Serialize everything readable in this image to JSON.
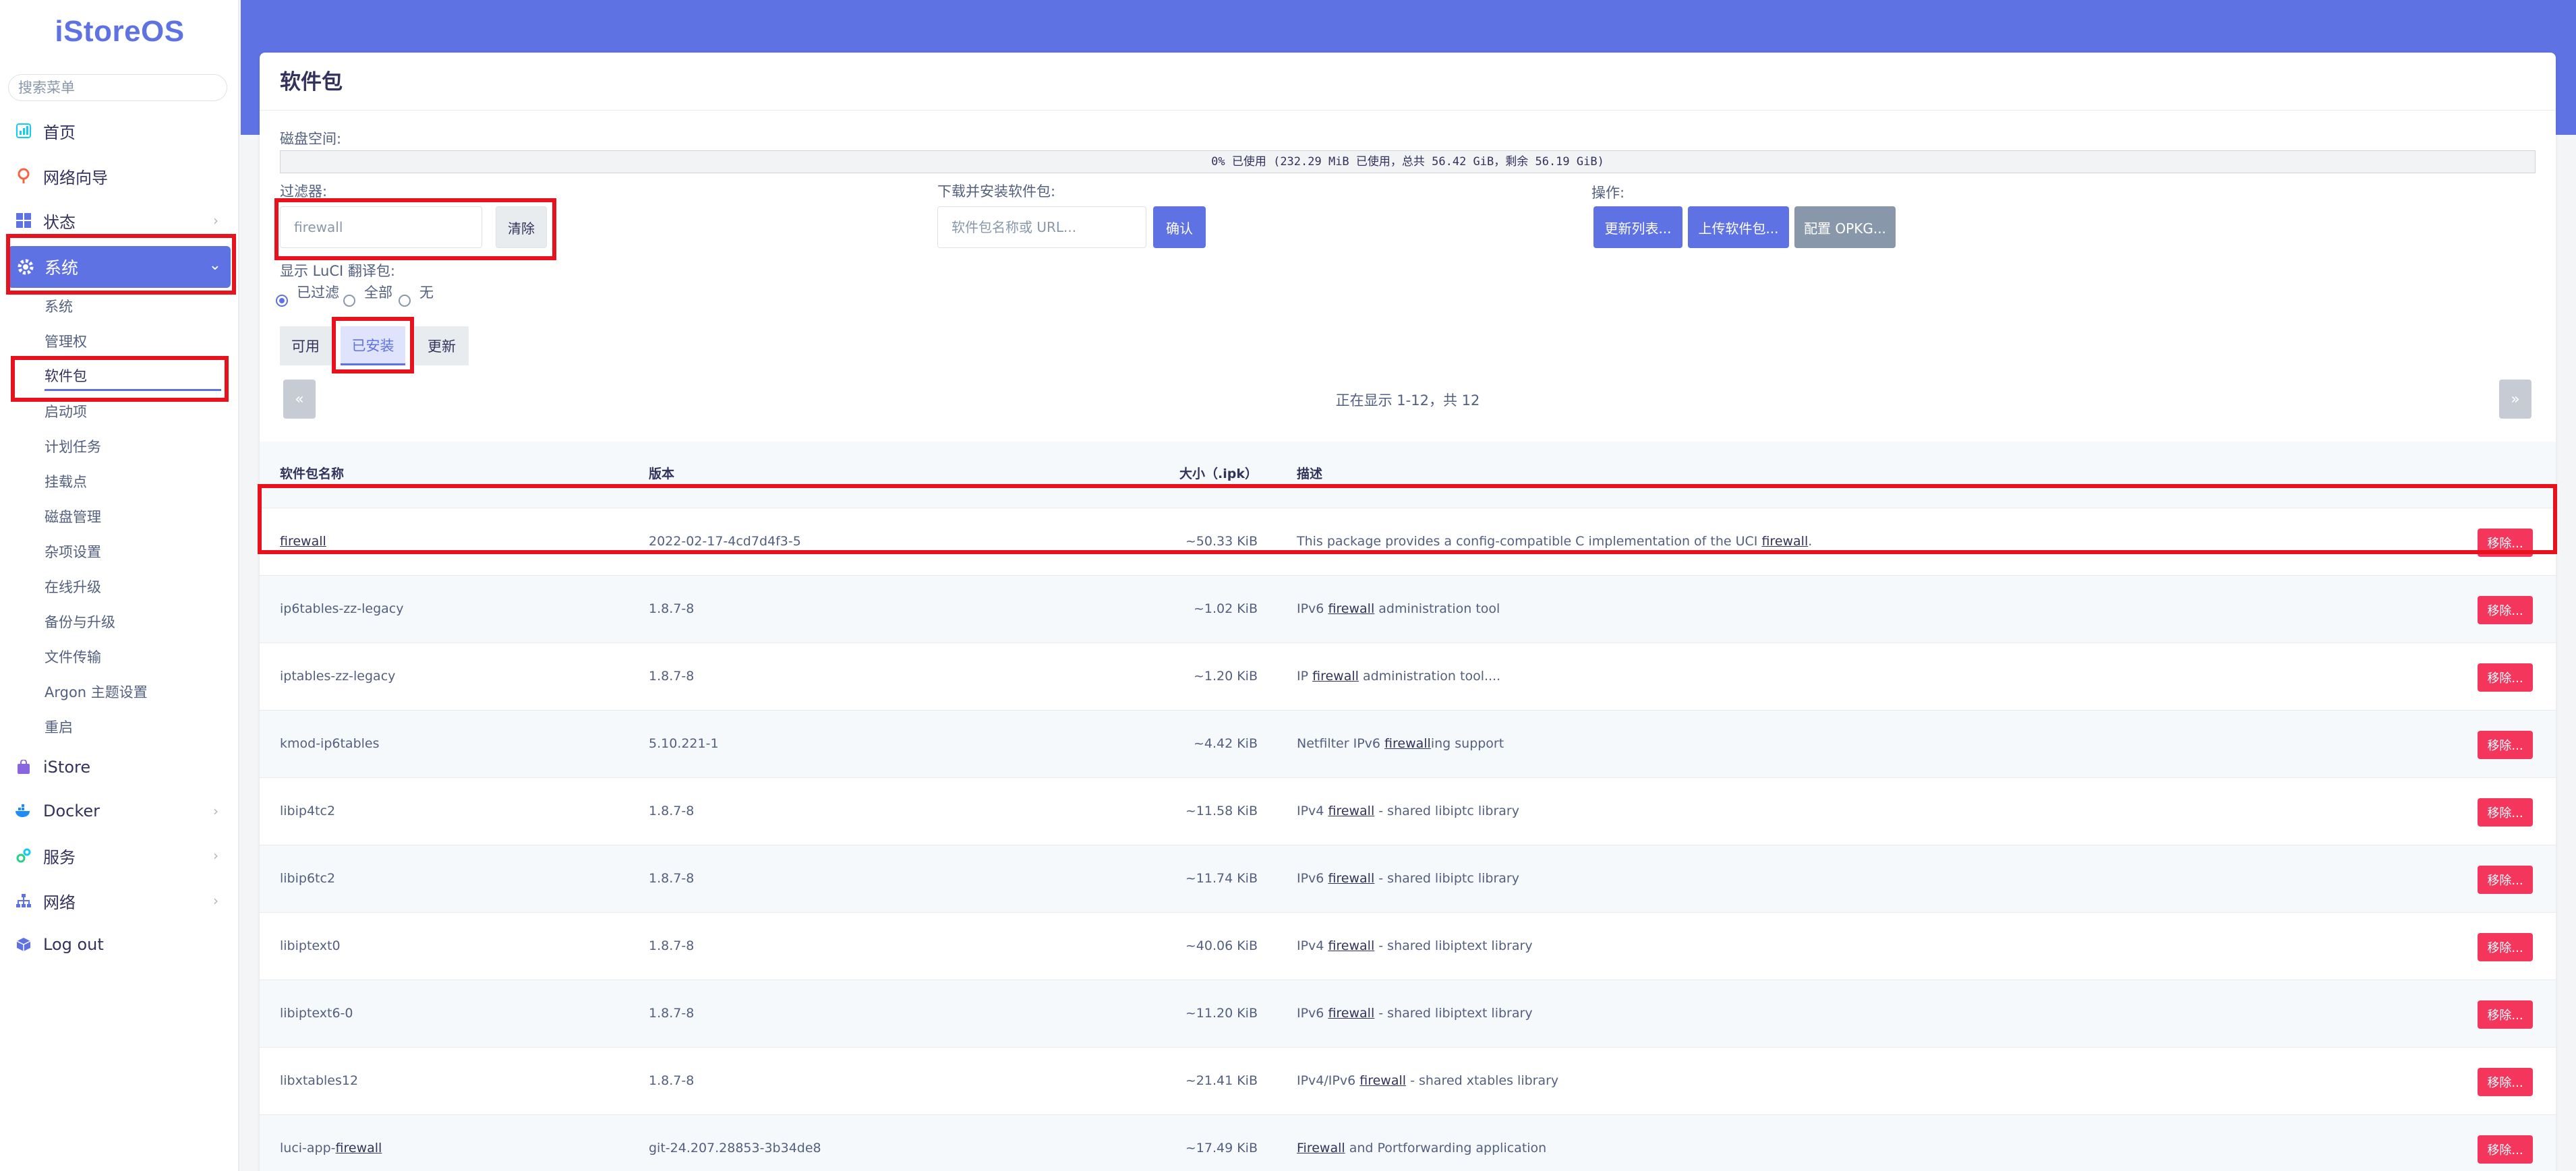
{
  "brand": "iStoreOS",
  "sidebar": {
    "search_placeholder": "搜索菜单",
    "items": [
      {
        "label": "首页",
        "icon": "dashboard-icon"
      },
      {
        "label": "网络向导",
        "icon": "wizard-icon"
      },
      {
        "label": "状态",
        "icon": "status-grid-icon"
      },
      {
        "label": "系统",
        "icon": "gear-icon"
      },
      {
        "label": "iStore",
        "icon": "store-icon"
      },
      {
        "label": "Docker",
        "icon": "docker-icon"
      },
      {
        "label": "服务",
        "icon": "service-icon"
      },
      {
        "label": "网络",
        "icon": "network-icon"
      },
      {
        "label": "Log out",
        "icon": "logout-icon"
      }
    ],
    "system_sub": [
      "系统",
      "管理权",
      "软件包",
      "启动项",
      "计划任务",
      "挂载点",
      "磁盘管理",
      "杂项设置",
      "在线升级",
      "备份与升级",
      "文件传输",
      "Argon 主题设置",
      "重启"
    ]
  },
  "page": {
    "title": "软件包",
    "disk_label": "磁盘空间:",
    "disk_text": "0% 已使用 (232.29 MiB 已使用，总共 56.42 GiB，剩余 56.19 GiB)",
    "disk_used_fraction": 0.0,
    "filter_label": "过滤器:",
    "filter_value": "firewall",
    "clear_label": "清除",
    "download_label": "下载并安装软件包:",
    "download_placeholder": "软件包名称或 URL...",
    "confirm_label": "确认",
    "actions_label": "操作:",
    "update_list_label": "更新列表...",
    "upload_label": "上传软件包...",
    "config_opkg_label": "配置 OPKG...",
    "luci_label": "显示 LuCI 翻译包:",
    "radio_filtered": "已过滤",
    "radio_all": "全部",
    "radio_none": "无",
    "tab_available": "可用",
    "tab_installed": "已安装",
    "tab_updates": "更新",
    "pager_prev": "«",
    "pager_next": "»",
    "pager_text": "正在显示 1-12，共 12"
  },
  "table": {
    "headers": {
      "name": "软件包名称",
      "version": "版本",
      "size": "大小（.ipk）",
      "desc": "描述"
    },
    "remove_label": "移除...",
    "rows": [
      {
        "name": "firewall",
        "version": "2022-02-17-4cd7d4f3-5",
        "size": "~50.33 KiB",
        "desc_pre": "This package provides a config-compatible C implementation of the UCI ",
        "desc_link": "firewall",
        "desc_post": "."
      },
      {
        "name": "ip6tables-zz-legacy",
        "version": "1.8.7-8",
        "size": "~1.02 KiB",
        "desc_pre": "IPv6 ",
        "desc_link": "firewall",
        "desc_post": " administration tool"
      },
      {
        "name": "iptables-zz-legacy",
        "version": "1.8.7-8",
        "size": "~1.20 KiB",
        "desc_pre": "IP ",
        "desc_link": "firewall",
        "desc_post": " administration tool...."
      },
      {
        "name": "kmod-ip6tables",
        "version": "5.10.221-1",
        "size": "~4.42 KiB",
        "desc_pre": "Netfilter IPv6 ",
        "desc_link": "firewall",
        "desc_post": "ing support"
      },
      {
        "name": "libip4tc2",
        "version": "1.8.7-8",
        "size": "~11.58 KiB",
        "desc_pre": "IPv4 ",
        "desc_link": "firewall",
        "desc_post": " - shared libiptc library"
      },
      {
        "name": "libip6tc2",
        "version": "1.8.7-8",
        "size": "~11.74 KiB",
        "desc_pre": "IPv6 ",
        "desc_link": "firewall",
        "desc_post": " - shared libiptc library"
      },
      {
        "name": "libiptext0",
        "version": "1.8.7-8",
        "size": "~40.06 KiB",
        "desc_pre": "IPv4 ",
        "desc_link": "firewall",
        "desc_post": " - shared libiptext library"
      },
      {
        "name": "libiptext6-0",
        "version": "1.8.7-8",
        "size": "~11.20 KiB",
        "desc_pre": "IPv6 ",
        "desc_link": "firewall",
        "desc_post": " - shared libiptext library"
      },
      {
        "name": "libxtables12",
        "version": "1.8.7-8",
        "size": "~21.41 KiB",
        "desc_pre": "IPv4/IPv6 ",
        "desc_link": "firewall",
        "desc_post": " - shared xtables library"
      },
      {
        "name_pre": "luci-app-",
        "name_link": "firewall",
        "version": "git-24.207.28853-3b34de8",
        "size": "~17.49 KiB",
        "desc_pre": "",
        "desc_link": "Firewall",
        "desc_post": " and Portforwarding application"
      }
    ]
  }
}
